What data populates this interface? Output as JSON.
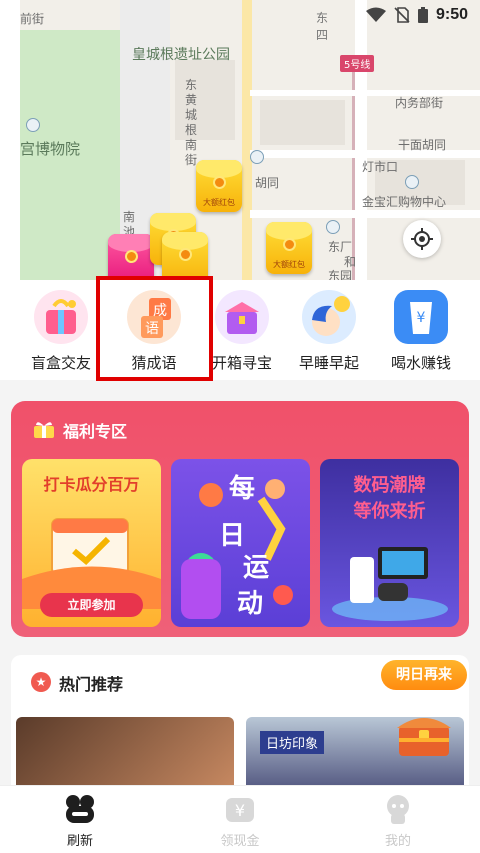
{
  "status_bar": {
    "location": "东四",
    "time": "9:50"
  },
  "map": {
    "labels": {
      "street_top_left": "前街",
      "park": "皇城根遗址公园",
      "museum": "宫博物院",
      "metro_line": "5号线",
      "neiwubu": "内务部街",
      "qianmian": "干面胡同",
      "dengshikou": "灯市口",
      "jinbao": "金宝汇购物中心",
      "donghuang": "东黄城根南街",
      "hutong": "胡同",
      "nan": "南池",
      "dongchang": "东厂",
      "he": "和",
      "dongyuan": "东园"
    },
    "red_envelope_label": "大额红包"
  },
  "quick_actions": [
    {
      "label": "盲盒交友",
      "icon": "blind-box-icon"
    },
    {
      "label": "猜成语",
      "icon": "idiom-icon",
      "icon_text_1": "成",
      "icon_text_2": "语"
    },
    {
      "label": "开箱寻宝",
      "icon": "treasure-box-icon"
    },
    {
      "label": "早睡早起",
      "icon": "sleep-icon"
    },
    {
      "label": "喝水赚钱",
      "icon": "water-cup-icon",
      "icon_text": "¥"
    }
  ],
  "welfare": {
    "title": "福利专区",
    "cards": [
      {
        "title": "打卡瓜分百万",
        "button": "立即参加"
      },
      {
        "title_chars": [
          "每",
          "日",
          "运",
          "动"
        ]
      },
      {
        "title_line1": "数码潮牌",
        "title_line2": "等你来折"
      }
    ]
  },
  "hot": {
    "title": "热门推荐",
    "tomorrow": "明日再来",
    "thumb_text": "日坊印象"
  },
  "nav": [
    {
      "label": "刷新",
      "active": true
    },
    {
      "label": "领现金",
      "active": false
    },
    {
      "label": "我的",
      "active": false
    }
  ],
  "colors": {
    "accent_red": "#ef566e",
    "orange": "#ff9b1a"
  }
}
